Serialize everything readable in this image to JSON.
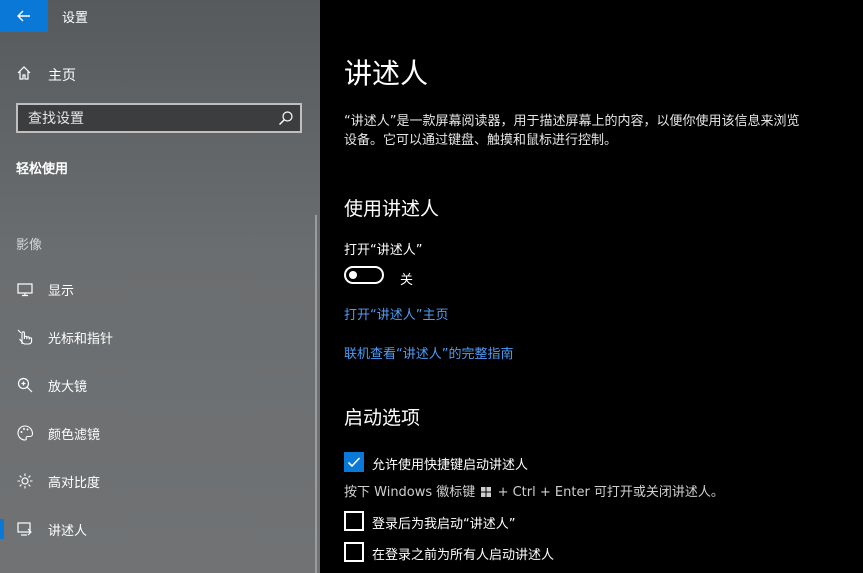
{
  "app": {
    "title": "设置"
  },
  "sidebar": {
    "home_label": "主页",
    "search": {
      "placeholder": "查找设置"
    },
    "section_title": "轻松使用",
    "group_label": "影像",
    "items": [
      {
        "label": "显示",
        "icon": "monitor-icon"
      },
      {
        "label": "光标和指针",
        "icon": "pointer-icon"
      },
      {
        "label": "放大镜",
        "icon": "magnifier-icon"
      },
      {
        "label": "颜色滤镜",
        "icon": "palette-icon"
      },
      {
        "label": "高对比度",
        "icon": "contrast-icon"
      },
      {
        "label": "讲述人",
        "icon": "narrator-icon",
        "selected": true
      }
    ]
  },
  "main": {
    "title": "讲述人",
    "description": "“讲述人”是一款屏幕阅读器，用于描述屏幕上的内容，以便你使用该信息来浏览设备。它可以通过键盘、触摸和鼠标进行控制。",
    "use_section": {
      "heading": "使用讲述人",
      "toggle_label": "打开“讲述人”",
      "toggle_state": "关",
      "toggle_on": false,
      "link_home": "打开“讲述人”主页",
      "link_guide": "联机查看“讲述人”的完整指南"
    },
    "startup_section": {
      "heading": "启动选项",
      "option1": {
        "label": "允许使用快捷键启动讲述人",
        "checked": true
      },
      "hint_pre": "按下 Windows 徽标键",
      "hint_post": "+ Ctrl + Enter 可打开或关闭讲述人。",
      "option2": {
        "label": "登录后为我启动“讲述人”",
        "checked": false
      },
      "option3": {
        "label": "在登录之前为所有人启动讲述人",
        "checked": false
      }
    }
  },
  "colors": {
    "accent": "#0a78d7",
    "link": "#4f9cf5"
  }
}
